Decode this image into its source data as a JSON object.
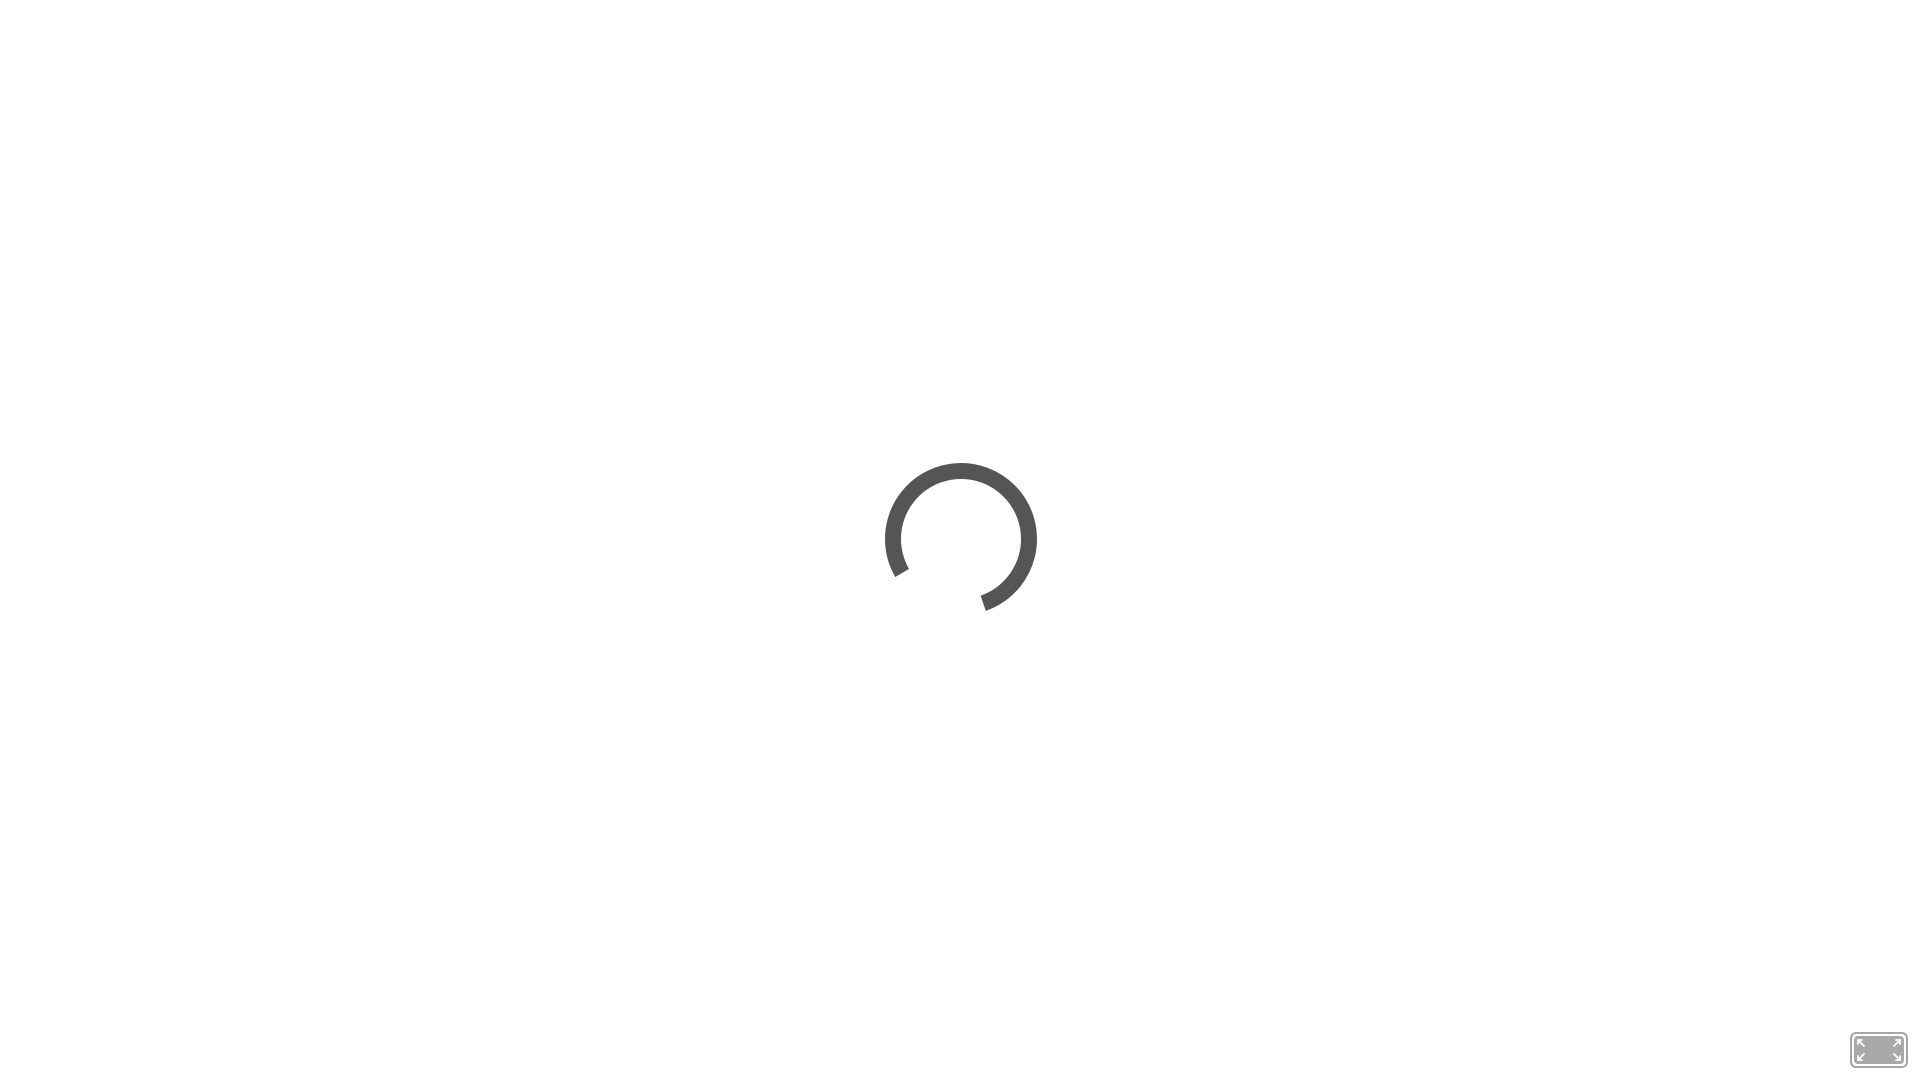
{
  "loader": {
    "icon": "loading-spinner-icon",
    "color": "#555555",
    "arc_fraction": 0.78
  },
  "controls": {
    "fullscreen_icon": "expand-arrows-icon",
    "border_color": "#a6a6a6",
    "fill_color": "#a9a9a9",
    "arrow_color": "#ffffff"
  }
}
